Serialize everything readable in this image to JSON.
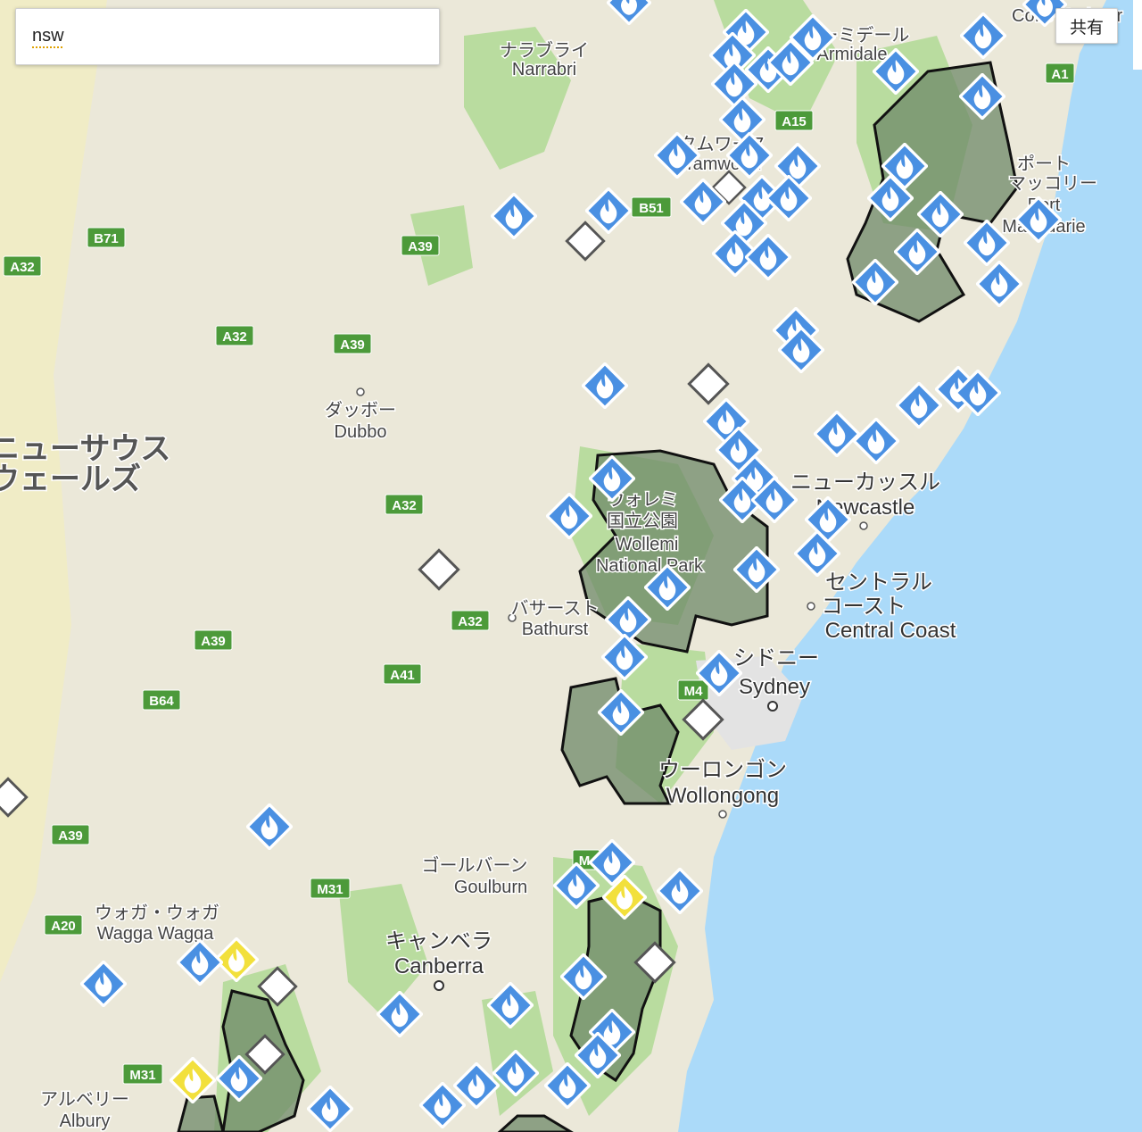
{
  "search": {
    "query": "nsw"
  },
  "share": {
    "label": "共有"
  },
  "colors": {
    "ocean": "#abdaf9",
    "land": "#ebe8d9",
    "green": "#b9dc9f",
    "burn_area": "#6f8a68",
    "fire_icon": "#4a90e2",
    "advice_diamond": "#f2e03c",
    "status_diamond": "#ffffff"
  },
  "roads": {
    "A39_n": "A39",
    "B51": "B51",
    "A15": "A15",
    "A1": "A1",
    "B71": "B71",
    "A32_w": "A32",
    "A32_c": "A32",
    "A39_c": "A39",
    "A32_s": "A32",
    "A32_d": "A32",
    "A39_sw": "A39",
    "A41": "A41",
    "B64": "B64",
    "M4": "M4",
    "A39_w": "A39",
    "M31_c": "M31",
    "A20": "A20",
    "M31_s": "M31",
    "M_partial": "M"
  },
  "places": {
    "narrabri_ja": "ナラブライ",
    "narrabri_en": "Narrabri",
    "armidale_ja": "アーミデール",
    "armidale_en": "Armidale",
    "tamworth_ja": "タムワース",
    "tamworth_en": "Tamworth",
    "portmac_ja1": "ポート",
    "portmac_ja2": "マッコリー",
    "portmac_en1": "Port",
    "portmac_en2": "Macquarie",
    "coffs_en": "Coffs Harbour",
    "dubbo_ja": "ダッボー",
    "dubbo_en": "Dubbo",
    "nsw_ja1": "ニューサウス",
    "nsw_ja2": "ウェールズ",
    "wollemi_ja1": "ウォレミ",
    "wollemi_ja2": "国立公園",
    "wollemi_en1": "Wollemi",
    "wollemi_en2": "National Park",
    "newcastle_ja": "ニューカッスル",
    "newcastle_en": "Newcastle",
    "central_ja1": "セントラル",
    "central_ja2": "コースト",
    "central_en": "Central Coast",
    "bathurst_ja": "バサースト",
    "bathurst_en": "Bathurst",
    "sydney_ja": "シドニー",
    "sydney_en": "Sydney",
    "wollongong_ja": "ウーロンゴン",
    "wollongong_en": "Wollongong",
    "goulburn_ja": "ゴールバーン",
    "goulburn_en": "Goulburn",
    "wagga_ja": "ウォガ・ウォガ",
    "wagga_en": "Wagga Wagga",
    "canberra_ja": "キャンベラ",
    "canberra_en": "Canberra",
    "albury_ja": "アルベリー",
    "albury_en": "Albury"
  }
}
